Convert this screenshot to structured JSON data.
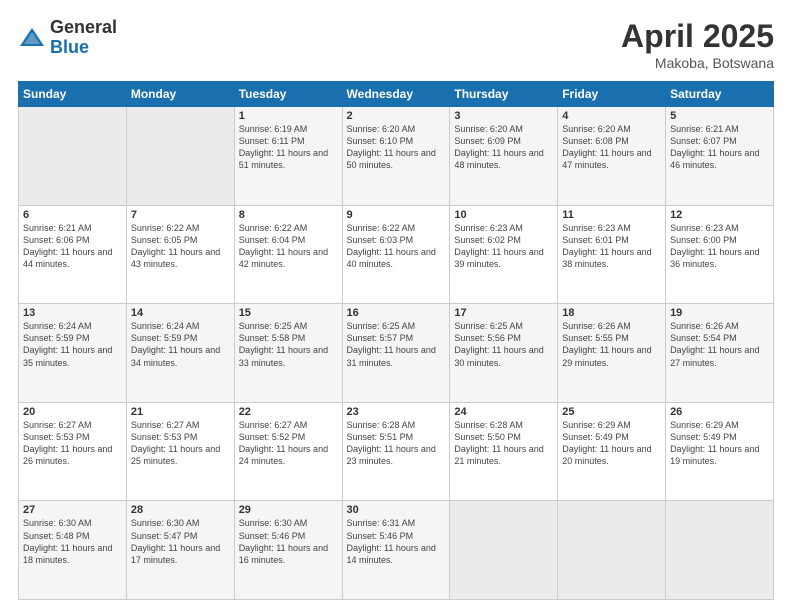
{
  "header": {
    "logo_general": "General",
    "logo_blue": "Blue",
    "month_title": "April 2025",
    "location": "Makoba, Botswana"
  },
  "days_of_week": [
    "Sunday",
    "Monday",
    "Tuesday",
    "Wednesday",
    "Thursday",
    "Friday",
    "Saturday"
  ],
  "weeks": [
    [
      {
        "day": "",
        "sunrise": "",
        "sunset": "",
        "daylight": ""
      },
      {
        "day": "",
        "sunrise": "",
        "sunset": "",
        "daylight": ""
      },
      {
        "day": "1",
        "sunrise": "Sunrise: 6:19 AM",
        "sunset": "Sunset: 6:11 PM",
        "daylight": "Daylight: 11 hours and 51 minutes."
      },
      {
        "day": "2",
        "sunrise": "Sunrise: 6:20 AM",
        "sunset": "Sunset: 6:10 PM",
        "daylight": "Daylight: 11 hours and 50 minutes."
      },
      {
        "day": "3",
        "sunrise": "Sunrise: 6:20 AM",
        "sunset": "Sunset: 6:09 PM",
        "daylight": "Daylight: 11 hours and 48 minutes."
      },
      {
        "day": "4",
        "sunrise": "Sunrise: 6:20 AM",
        "sunset": "Sunset: 6:08 PM",
        "daylight": "Daylight: 11 hours and 47 minutes."
      },
      {
        "day": "5",
        "sunrise": "Sunrise: 6:21 AM",
        "sunset": "Sunset: 6:07 PM",
        "daylight": "Daylight: 11 hours and 46 minutes."
      }
    ],
    [
      {
        "day": "6",
        "sunrise": "Sunrise: 6:21 AM",
        "sunset": "Sunset: 6:06 PM",
        "daylight": "Daylight: 11 hours and 44 minutes."
      },
      {
        "day": "7",
        "sunrise": "Sunrise: 6:22 AM",
        "sunset": "Sunset: 6:05 PM",
        "daylight": "Daylight: 11 hours and 43 minutes."
      },
      {
        "day": "8",
        "sunrise": "Sunrise: 6:22 AM",
        "sunset": "Sunset: 6:04 PM",
        "daylight": "Daylight: 11 hours and 42 minutes."
      },
      {
        "day": "9",
        "sunrise": "Sunrise: 6:22 AM",
        "sunset": "Sunset: 6:03 PM",
        "daylight": "Daylight: 11 hours and 40 minutes."
      },
      {
        "day": "10",
        "sunrise": "Sunrise: 6:23 AM",
        "sunset": "Sunset: 6:02 PM",
        "daylight": "Daylight: 11 hours and 39 minutes."
      },
      {
        "day": "11",
        "sunrise": "Sunrise: 6:23 AM",
        "sunset": "Sunset: 6:01 PM",
        "daylight": "Daylight: 11 hours and 38 minutes."
      },
      {
        "day": "12",
        "sunrise": "Sunrise: 6:23 AM",
        "sunset": "Sunset: 6:00 PM",
        "daylight": "Daylight: 11 hours and 36 minutes."
      }
    ],
    [
      {
        "day": "13",
        "sunrise": "Sunrise: 6:24 AM",
        "sunset": "Sunset: 5:59 PM",
        "daylight": "Daylight: 11 hours and 35 minutes."
      },
      {
        "day": "14",
        "sunrise": "Sunrise: 6:24 AM",
        "sunset": "Sunset: 5:59 PM",
        "daylight": "Daylight: 11 hours and 34 minutes."
      },
      {
        "day": "15",
        "sunrise": "Sunrise: 6:25 AM",
        "sunset": "Sunset: 5:58 PM",
        "daylight": "Daylight: 11 hours and 33 minutes."
      },
      {
        "day": "16",
        "sunrise": "Sunrise: 6:25 AM",
        "sunset": "Sunset: 5:57 PM",
        "daylight": "Daylight: 11 hours and 31 minutes."
      },
      {
        "day": "17",
        "sunrise": "Sunrise: 6:25 AM",
        "sunset": "Sunset: 5:56 PM",
        "daylight": "Daylight: 11 hours and 30 minutes."
      },
      {
        "day": "18",
        "sunrise": "Sunrise: 6:26 AM",
        "sunset": "Sunset: 5:55 PM",
        "daylight": "Daylight: 11 hours and 29 minutes."
      },
      {
        "day": "19",
        "sunrise": "Sunrise: 6:26 AM",
        "sunset": "Sunset: 5:54 PM",
        "daylight": "Daylight: 11 hours and 27 minutes."
      }
    ],
    [
      {
        "day": "20",
        "sunrise": "Sunrise: 6:27 AM",
        "sunset": "Sunset: 5:53 PM",
        "daylight": "Daylight: 11 hours and 26 minutes."
      },
      {
        "day": "21",
        "sunrise": "Sunrise: 6:27 AM",
        "sunset": "Sunset: 5:53 PM",
        "daylight": "Daylight: 11 hours and 25 minutes."
      },
      {
        "day": "22",
        "sunrise": "Sunrise: 6:27 AM",
        "sunset": "Sunset: 5:52 PM",
        "daylight": "Daylight: 11 hours and 24 minutes."
      },
      {
        "day": "23",
        "sunrise": "Sunrise: 6:28 AM",
        "sunset": "Sunset: 5:51 PM",
        "daylight": "Daylight: 11 hours and 23 minutes."
      },
      {
        "day": "24",
        "sunrise": "Sunrise: 6:28 AM",
        "sunset": "Sunset: 5:50 PM",
        "daylight": "Daylight: 11 hours and 21 minutes."
      },
      {
        "day": "25",
        "sunrise": "Sunrise: 6:29 AM",
        "sunset": "Sunset: 5:49 PM",
        "daylight": "Daylight: 11 hours and 20 minutes."
      },
      {
        "day": "26",
        "sunrise": "Sunrise: 6:29 AM",
        "sunset": "Sunset: 5:49 PM",
        "daylight": "Daylight: 11 hours and 19 minutes."
      }
    ],
    [
      {
        "day": "27",
        "sunrise": "Sunrise: 6:30 AM",
        "sunset": "Sunset: 5:48 PM",
        "daylight": "Daylight: 11 hours and 18 minutes."
      },
      {
        "day": "28",
        "sunrise": "Sunrise: 6:30 AM",
        "sunset": "Sunset: 5:47 PM",
        "daylight": "Daylight: 11 hours and 17 minutes."
      },
      {
        "day": "29",
        "sunrise": "Sunrise: 6:30 AM",
        "sunset": "Sunset: 5:46 PM",
        "daylight": "Daylight: 11 hours and 16 minutes."
      },
      {
        "day": "30",
        "sunrise": "Sunrise: 6:31 AM",
        "sunset": "Sunset: 5:46 PM",
        "daylight": "Daylight: 11 hours and 14 minutes."
      },
      {
        "day": "",
        "sunrise": "",
        "sunset": "",
        "daylight": ""
      },
      {
        "day": "",
        "sunrise": "",
        "sunset": "",
        "daylight": ""
      },
      {
        "day": "",
        "sunrise": "",
        "sunset": "",
        "daylight": ""
      }
    ]
  ]
}
